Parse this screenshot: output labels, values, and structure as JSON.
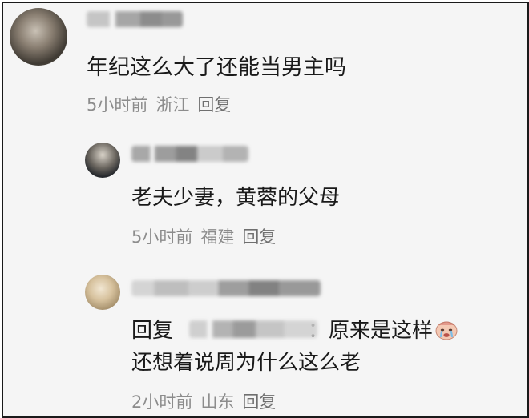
{
  "comments": [
    {
      "text": "年纪这么大了还能当男主吗",
      "time": "5小时前",
      "location": "浙江",
      "reply_label": "回复"
    },
    {
      "text": "老夫少妻，黄蓉的父母",
      "time": "5小时前",
      "location": "福建",
      "reply_label": "回复"
    },
    {
      "reply_prefix": "回复",
      "colon": "：",
      "text_part1": "原来是这样",
      "text_line2": "还想着说周为什么这么老",
      "emoji": "crying-face-emoji",
      "time": "2小时前",
      "location": "山东",
      "reply_label": "回复"
    }
  ]
}
